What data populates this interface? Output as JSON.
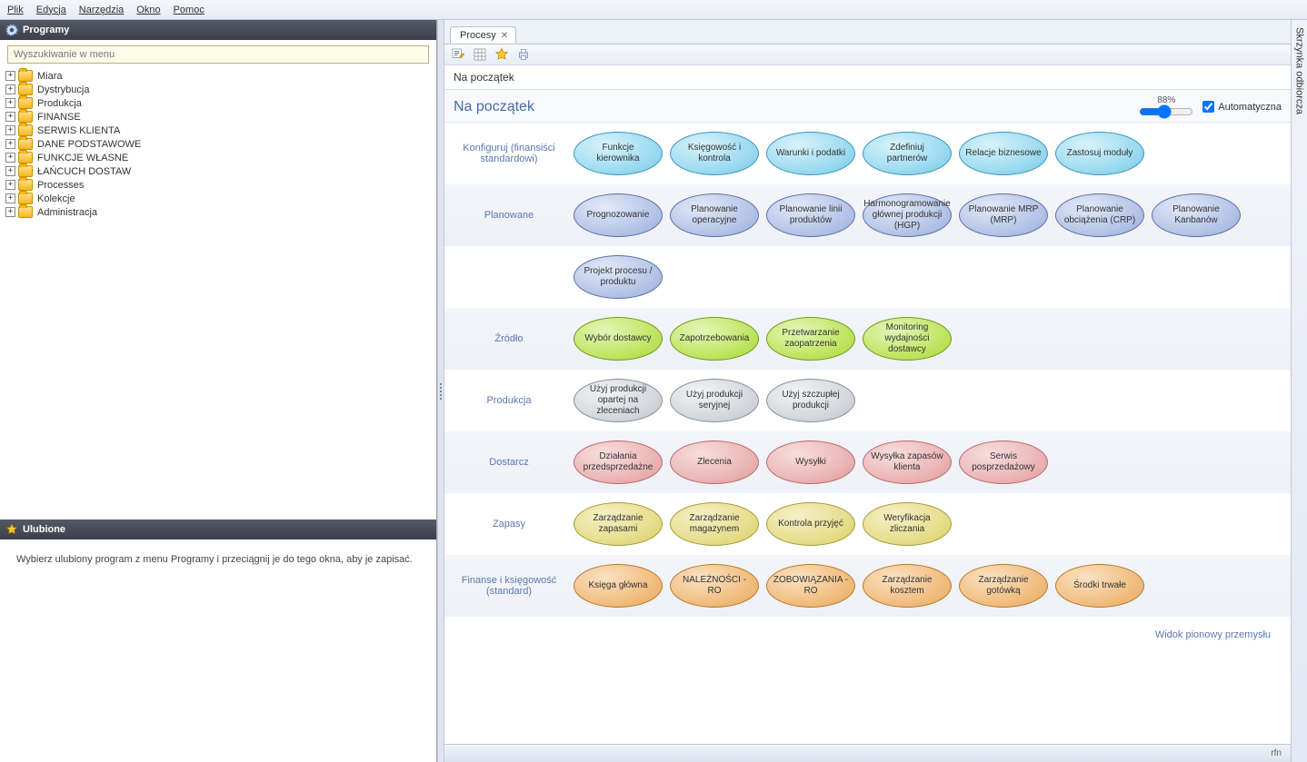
{
  "menu": {
    "items": [
      "Plik",
      "Edycja",
      "Narzędzia",
      "Okno",
      "Pomoc"
    ]
  },
  "sidebar": {
    "programs": {
      "title": "Programy",
      "search_placeholder": "Wyszukiwanie w menu",
      "items": [
        "Miara",
        "Dystrybucja",
        "Produkcja",
        "FINANSE",
        "SERWIS KLIENTA",
        "DANE PODSTAWOWE",
        "FUNKCJE WŁASNE",
        "ŁAŃCUCH DOSTAW",
        "Processes",
        "Kolekcje",
        "Administracja"
      ]
    },
    "favorites": {
      "title": "Ulubione",
      "hint": "Wybierz ulubiony program z menu Programy i przeciągnij je do tego okna, aby je zapisać."
    }
  },
  "main": {
    "tab_label": "Procesy",
    "breadcrumb": "Na początek",
    "page_title": "Na początek",
    "zoom_label": "88%",
    "auto_label": "Automatyczna",
    "auto_checked": true,
    "rows": [
      {
        "label": "Konfiguruj (finansiści standardowi)",
        "color": "c-cyan",
        "alt": false,
        "bubbles": [
          "Funkcje kierownika",
          "Księgowość i kontrola",
          "Warunki i podatki",
          "Zdefiniuj partnerów",
          "Relacje biznesowe",
          "Zastosuj moduły"
        ]
      },
      {
        "label": "Planowane",
        "color": "c-blue",
        "alt": true,
        "bubbles": [
          "Prognozowanie",
          "Planowanie operacyjne",
          "Planowanie linii produktów",
          "Harmonogramowanie głównej produkcji (HGP)",
          "Planowanie MRP (MRP)",
          "Planowanie obciążenia (CRP)",
          "Planowanie Kanbanów"
        ]
      },
      {
        "label": "",
        "color": "c-blue",
        "alt": false,
        "bubbles": [
          "Projekt procesu / produktu"
        ]
      },
      {
        "label": "Źródło",
        "color": "c-green",
        "alt": true,
        "bubbles": [
          "Wybór dostawcy",
          "Zapotrzebowania",
          "Przetwarzanie zaopatrzenia",
          "Monitoring wydajności dostawcy"
        ]
      },
      {
        "label": "Produkcja",
        "color": "c-grey",
        "alt": false,
        "bubbles": [
          "Użyj produkcji opartej na zleceniach",
          "Użyj produkcji seryjnej",
          "Użyj szczupłej produkcji"
        ]
      },
      {
        "label": "Dostarcz",
        "color": "c-red",
        "alt": true,
        "bubbles": [
          "Działania przedsprzedażne",
          "Zlecenia",
          "Wysyłki",
          "Wysyłka zapasów klienta",
          "Serwis posprzedażowy"
        ]
      },
      {
        "label": "Zapasy",
        "color": "c-yel",
        "alt": false,
        "bubbles": [
          "Zarządzanie zapasami",
          "Zarządzanie magazynem",
          "Kontrola przyjęć",
          "Weryfikacja zliczania"
        ]
      },
      {
        "label": "Finanse i księgowość (standard)",
        "color": "c-org",
        "alt": true,
        "bubbles": [
          "Księga główna",
          "NALEŻNOŚCI - RO",
          "ZOBOWIĄZANIA - RO",
          "Zarządzanie kosztem",
          "Zarządzanie gotówką",
          "Środki trwałe"
        ]
      }
    ],
    "footer_link": "Widok pionowy przemysłu"
  },
  "right_dock": "Skrzynka odbiorcza",
  "status": "rfn"
}
